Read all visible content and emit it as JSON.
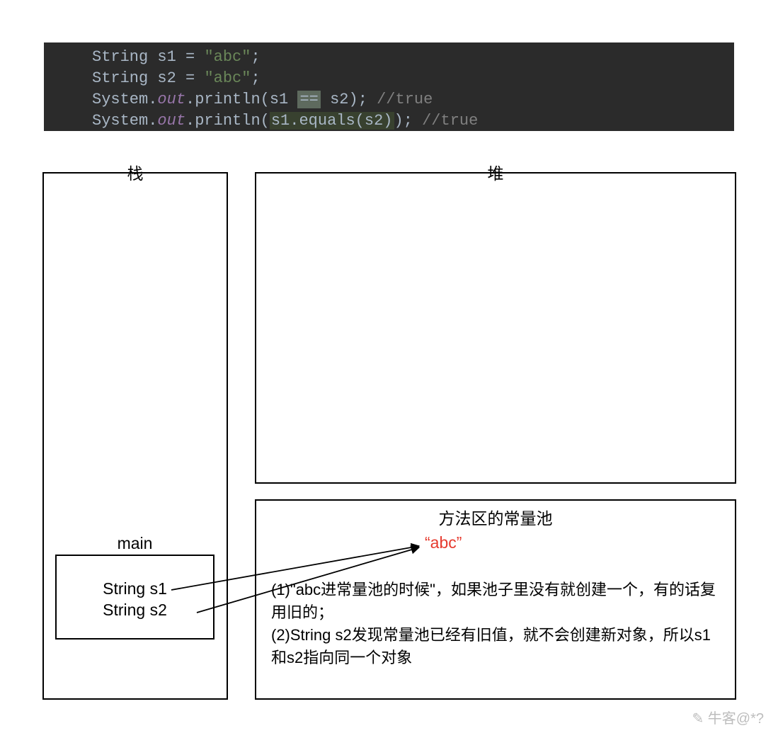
{
  "code": {
    "line1_type": "String ",
    "line1_var": "s1 ",
    "assign": "= ",
    "line1_str": "\"abc\"",
    "semicolon": ";",
    "line2_type": "String ",
    "line2_var": "s2 ",
    "line2_str": "\"abc\"",
    "line3_sys": "System.",
    "line3_out": "out",
    "line3_call": ".println(",
    "line3_arg": "s1 ",
    "line3_op": "==",
    "line3_arg2": " s2",
    "line3_close": ")",
    "line3_sc": "; ",
    "line3_comm": "//true",
    "line4_sys": "System.",
    "line4_out": "out",
    "line4_call": ".println(",
    "line4_arg": "s1.equals(s2)",
    "line4_close": ")",
    "line4_sc": "; ",
    "line4_comm": "//true"
  },
  "labels": {
    "stack": "栈",
    "heap": "堆",
    "pool": "方法区的常量池",
    "main": "main",
    "s1": "String s1",
    "s2": "String s2",
    "abc": "“abc”"
  },
  "notes": {
    "line1": "(1)\"abc进常量池的时候\"，如果池子里没有就创建一个，有的话复用旧的；",
    "line2": "(2)String s2发现常量池已经有旧值，就不会创建新对象，所以s1和s2指向同一个对象"
  },
  "watermark": "牛客@*?"
}
